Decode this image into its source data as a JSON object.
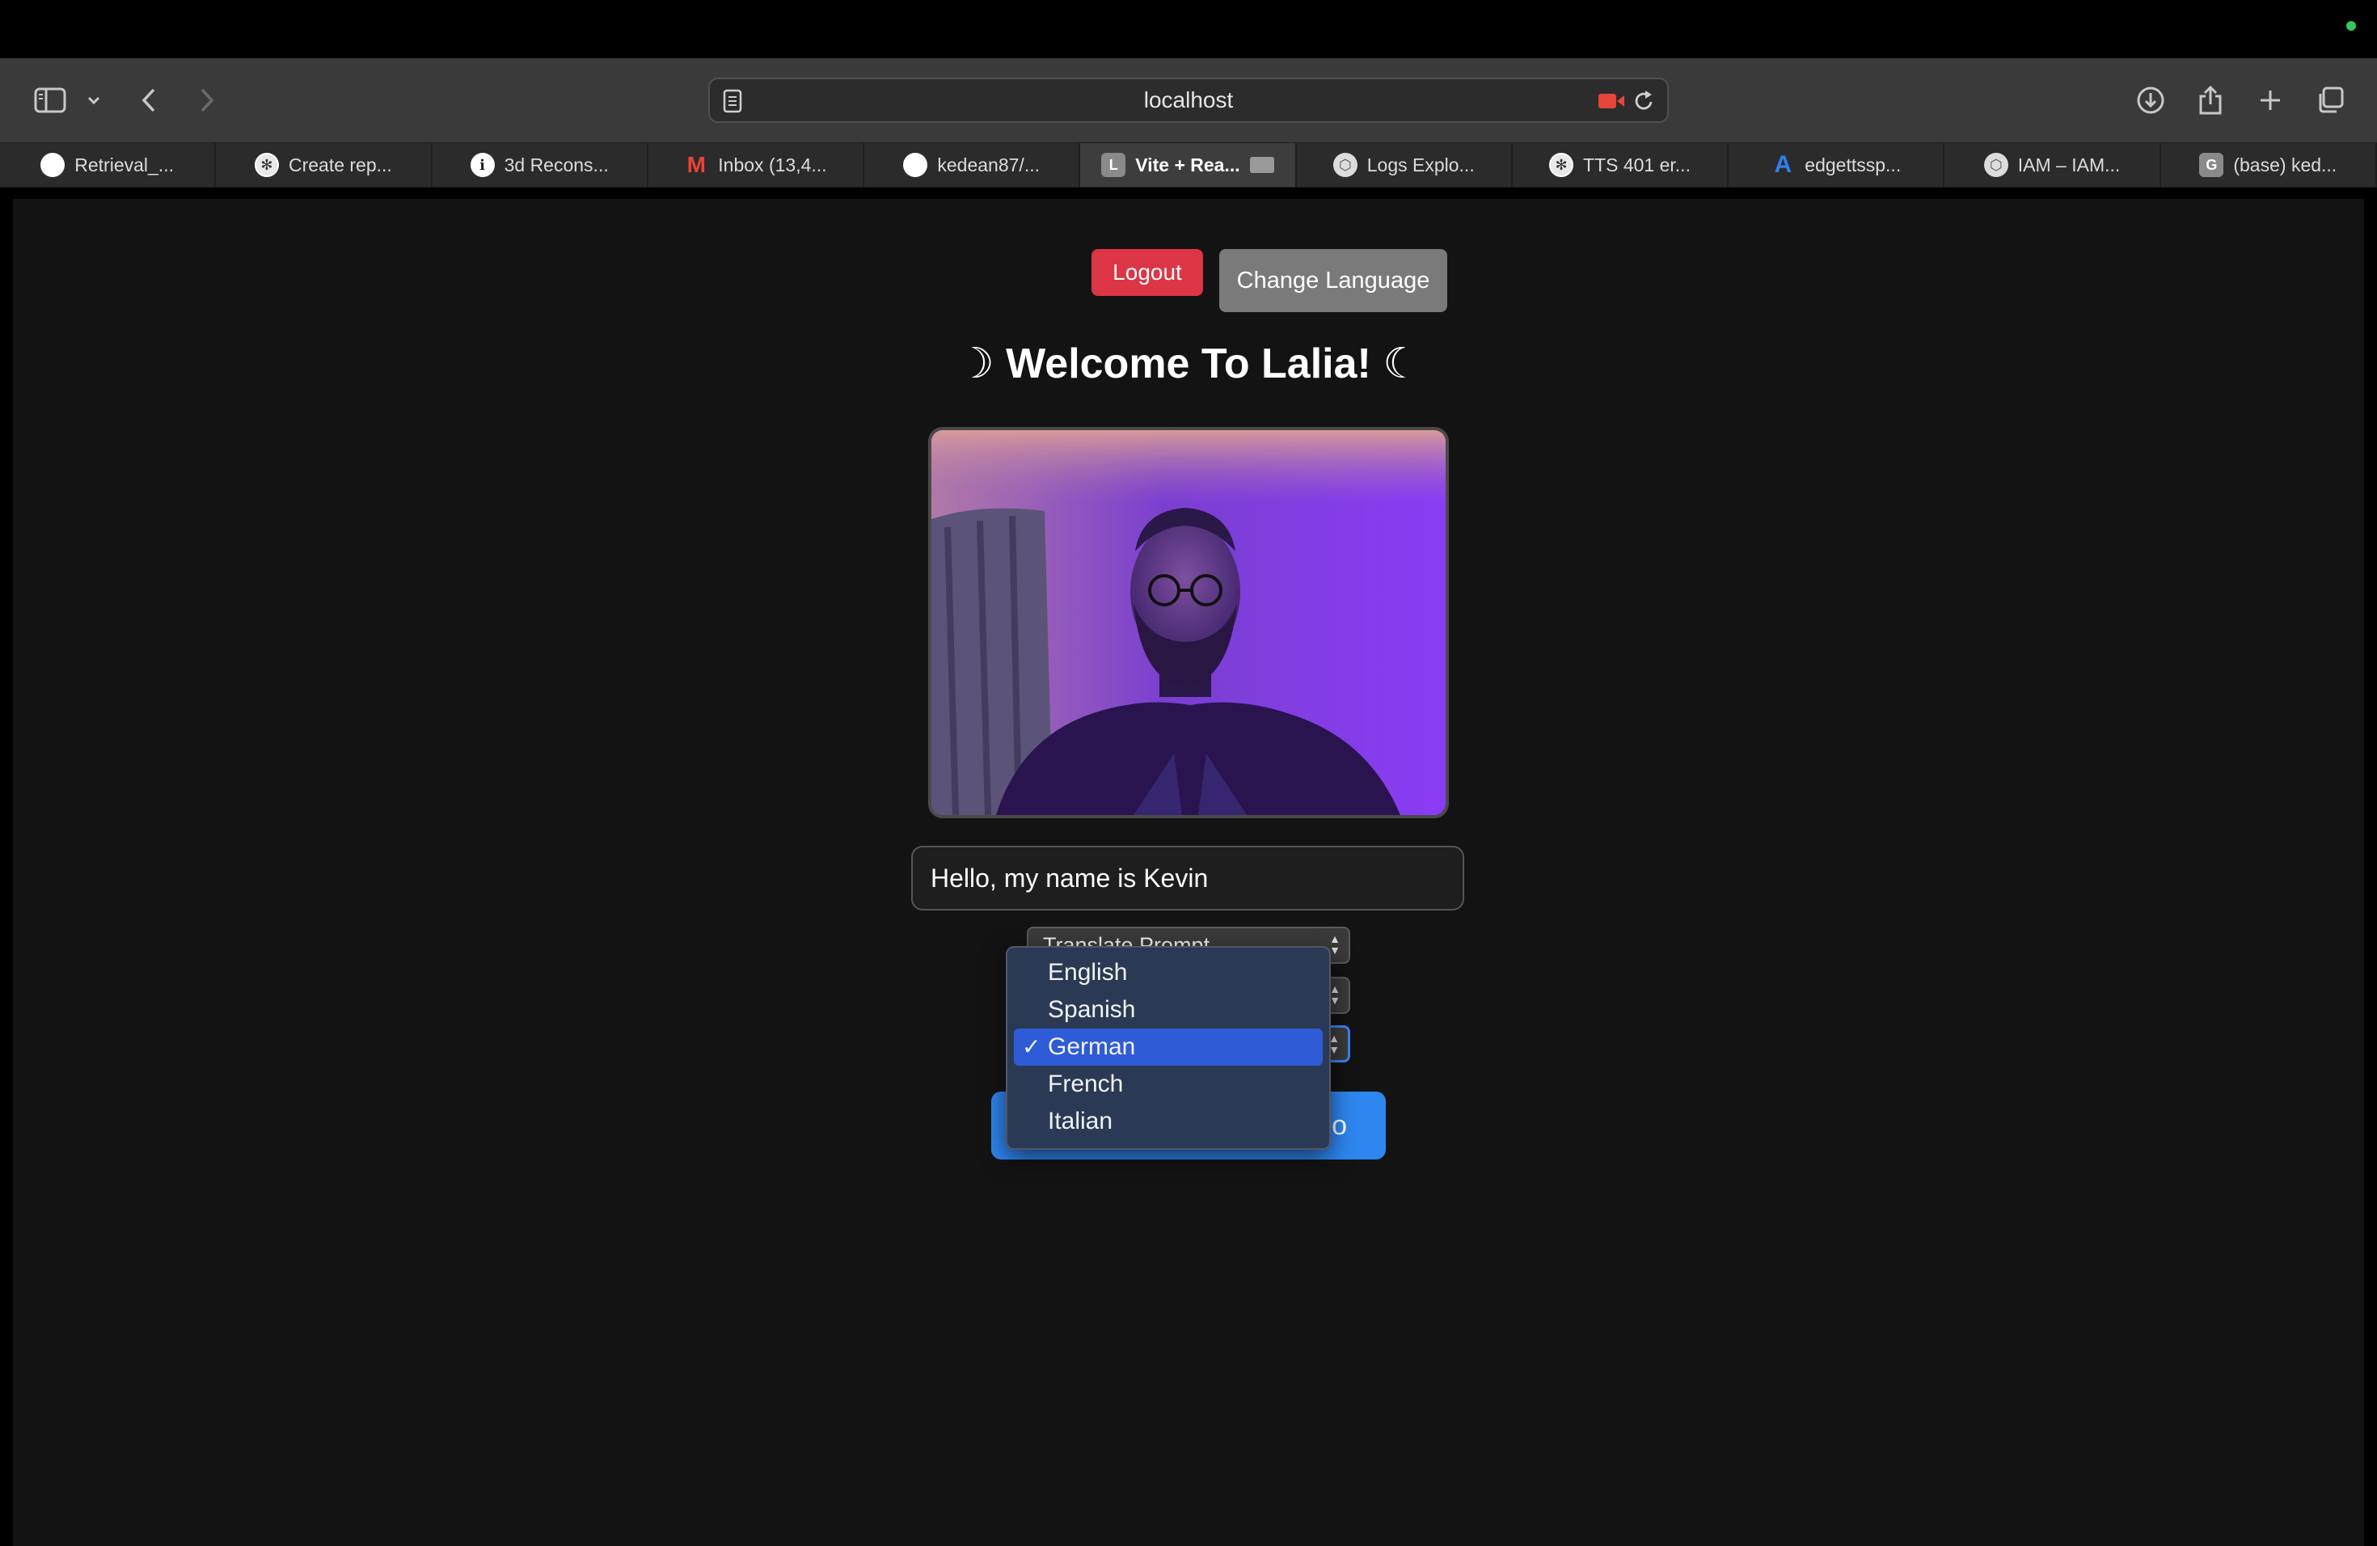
{
  "browser": {
    "address": "localhost",
    "tabs": [
      {
        "label": "Retrieval_...",
        "icon": "github-icon",
        "fav": "gh",
        "glyph": ""
      },
      {
        "label": "Create rep...",
        "icon": "openai-icon",
        "fav": "ai",
        "glyph": "✻"
      },
      {
        "label": "3d Recons...",
        "icon": "info-icon",
        "fav": "info",
        "glyph": "i"
      },
      {
        "label": "Inbox (13,4...",
        "icon": "gmail-icon",
        "fav": "mail",
        "glyph": "M"
      },
      {
        "label": "kedean87/...",
        "icon": "github-icon",
        "fav": "gh",
        "glyph": ""
      },
      {
        "label": "Vite + Rea...",
        "icon": "letter-l-icon",
        "fav": "letter",
        "glyph": "L",
        "active": true
      },
      {
        "label": "Logs Explo...",
        "icon": "gcp-icon",
        "fav": "gcp",
        "glyph": "⬡"
      },
      {
        "label": "TTS 401 er...",
        "icon": "openai-icon",
        "fav": "ai",
        "glyph": "✻"
      },
      {
        "label": "edgettssp...",
        "icon": "azure-icon",
        "fav": "az",
        "glyph": "A"
      },
      {
        "label": "IAM – IAM...",
        "icon": "gcp-icon",
        "fav": "gcp",
        "glyph": "⬡"
      },
      {
        "label": "(base) ked...",
        "icon": "letter-g-icon",
        "fav": "letter",
        "glyph": "G"
      }
    ]
  },
  "app": {
    "logout_label": "Logout",
    "change_language_label": "Change Language",
    "title": "☽ Welcome To Lalia! ☾",
    "input_value": "Hello, my name is Kevin",
    "select_1_value": "Translate Prompt",
    "primary_button_visible_label": "o"
  },
  "dropdown": {
    "options": [
      "English",
      "Spanish",
      "German",
      "French",
      "Italian"
    ],
    "selected": "German",
    "check": "✓"
  },
  "colors": {
    "logout": "#dc3545",
    "change_language": "#7a7a7a",
    "primary": "#2e86f0",
    "selected_option": "#2e5bd6"
  }
}
